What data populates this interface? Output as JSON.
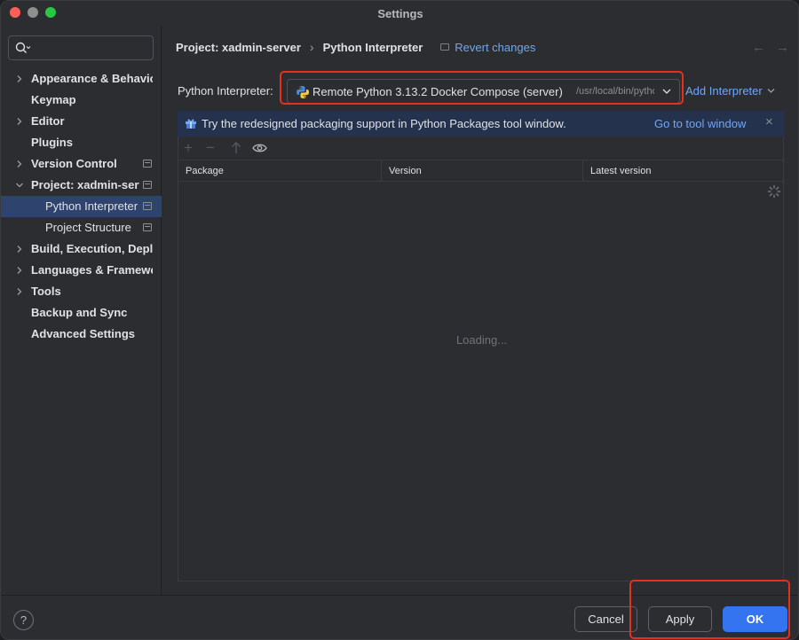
{
  "window": {
    "title": "Settings"
  },
  "search": {
    "placeholder": ""
  },
  "sidebar": {
    "items": [
      {
        "label": "Appearance & Behavior",
        "expandable": true
      },
      {
        "label": "Keymap",
        "expandable": false
      },
      {
        "label": "Editor",
        "expandable": true
      },
      {
        "label": "Plugins",
        "expandable": false
      },
      {
        "label": "Version Control",
        "expandable": true,
        "project_icon": true
      },
      {
        "label": "Project: xadmin-server",
        "expandable": true,
        "expanded": true,
        "project_icon": true
      },
      {
        "label": "Python Interpreter",
        "child": true,
        "selected": true,
        "project_icon": true
      },
      {
        "label": "Project Structure",
        "child": true,
        "project_icon": true
      },
      {
        "label": "Build, Execution, Deployment",
        "expandable": true
      },
      {
        "label": "Languages & Frameworks",
        "expandable": true
      },
      {
        "label": "Tools",
        "expandable": true
      },
      {
        "label": "Backup and Sync",
        "expandable": false
      },
      {
        "label": "Advanced Settings",
        "expandable": false
      }
    ]
  },
  "breadcrumb": {
    "project": "Project: xadmin-server",
    "separator": "›",
    "page": "Python Interpreter",
    "revert": "Revert changes"
  },
  "interpreter": {
    "label": "Python Interpreter:",
    "name": "Remote Python 3.13.2 Docker Compose (server)",
    "path": "/usr/local/bin/python",
    "add_label": "Add Interpreter"
  },
  "banner": {
    "text": "Try the redesigned packaging support in Python Packages tool window.",
    "link": "Go to tool window",
    "close": "×"
  },
  "packages": {
    "columns": [
      "Package",
      "Version",
      "Latest version"
    ],
    "status": "Loading..."
  },
  "footer": {
    "help": "?",
    "cancel": "Cancel",
    "apply": "Apply",
    "ok": "OK"
  },
  "colors": {
    "accent": "#3574f0",
    "link": "#6fa7f7",
    "highlight": "#e5301d",
    "selection": "#2e436e"
  }
}
